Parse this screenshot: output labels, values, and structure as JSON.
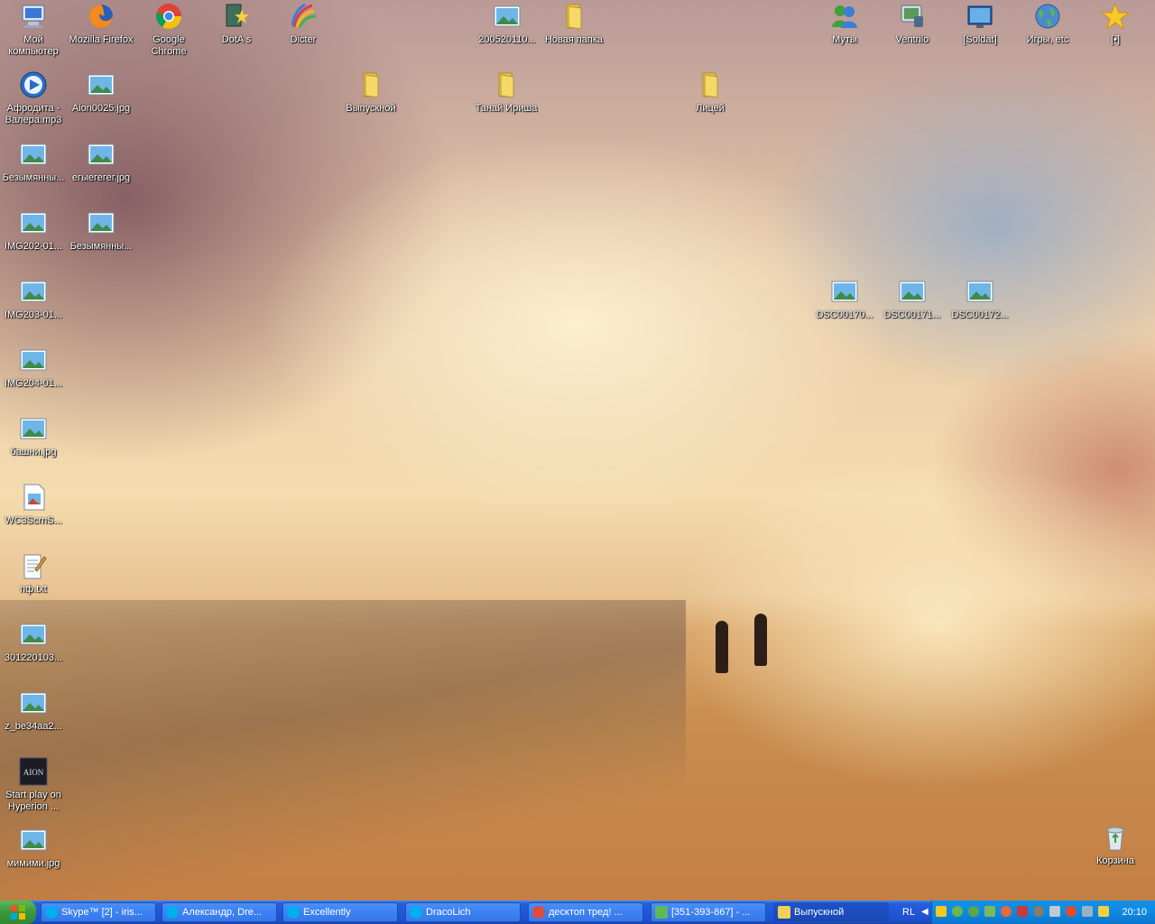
{
  "desktop_icons": [
    {
      "label": "Мой компьютер",
      "icon": "my-computer-icon"
    },
    {
      "label": "Mozilla Firefox",
      "icon": "firefox-icon"
    },
    {
      "label": "Google Chrome",
      "icon": "chrome-icon"
    },
    {
      "label": "DotA s",
      "icon": "dota-icon"
    },
    {
      "label": "Dicter",
      "icon": "dicter-icon"
    },
    {
      "label": "200520110...",
      "icon": "image-file-icon"
    },
    {
      "label": "Новая папка",
      "icon": "folder-icon"
    },
    {
      "label": "Муты",
      "icon": "contacts-icon"
    },
    {
      "label": "Ventrilo",
      "icon": "ventrilo-icon"
    },
    {
      "label": "[Soldat]",
      "icon": "soldat-icon"
    },
    {
      "label": "Игры, etc",
      "icon": "globe-icon"
    },
    {
      "label": "[•]",
      "icon": "star-icon"
    },
    {
      "label": "Афродита - Валера.mp3",
      "icon": "media-player-icon"
    },
    {
      "label": "Aion0025.jpg",
      "icon": "image-file-icon"
    },
    {
      "label": "Выпускной",
      "icon": "folder-icon"
    },
    {
      "label": "Танай Ириша",
      "icon": "folder-icon"
    },
    {
      "label": "Лицей",
      "icon": "folder-icon"
    },
    {
      "label": "Безымянны...",
      "icon": "image-file-icon"
    },
    {
      "label": "егыегегег.jpg",
      "icon": "image-file-icon"
    },
    {
      "label": "IMG202-01...",
      "icon": "image-file-icon"
    },
    {
      "label": "Безымянны...",
      "icon": "image-file-icon"
    },
    {
      "label": "IMG203-01...",
      "icon": "image-file-icon"
    },
    {
      "label": "DSC00170...",
      "icon": "image-file-icon"
    },
    {
      "label": "DSC00171...",
      "icon": "image-file-icon"
    },
    {
      "label": "DSC00172...",
      "icon": "image-file-icon"
    },
    {
      "label": "IMG204-01...",
      "icon": "image-file-icon"
    },
    {
      "label": "башни.jpg",
      "icon": "image-file-icon"
    },
    {
      "label": "WC3ScrnS...",
      "icon": "picture-doc-icon"
    },
    {
      "label": "пф.txt",
      "icon": "text-file-icon"
    },
    {
      "label": "301220103...",
      "icon": "image-file-icon"
    },
    {
      "label": "z_be34aa2...",
      "icon": "image-file-icon"
    },
    {
      "label": "Start play on Hyperion ...",
      "icon": "aion-icon"
    },
    {
      "label": "мимими.jpg",
      "icon": "image-file-icon"
    },
    {
      "label": "Корзина",
      "icon": "recycle-bin-icon"
    }
  ],
  "taskbar": {
    "start_icon": "windows-logo-icon",
    "tasks": [
      {
        "label": "Skype™ [2] - iris...",
        "icon": "skype-icon",
        "color": "#00aff0"
      },
      {
        "label": "Александр, Dre...",
        "icon": "skype-chat-icon",
        "color": "#00aff0"
      },
      {
        "label": "Excellently",
        "icon": "skype-chat-icon",
        "color": "#00aff0"
      },
      {
        "label": "DracoLich",
        "icon": "skype-chat-icon",
        "color": "#00aff0"
      },
      {
        "label": "десктоп тред! ...",
        "icon": "chrome-icon",
        "color": "#e04a3a"
      },
      {
        "label": "[351-393-867] - ...",
        "icon": "chat-icon",
        "color": "#5fb85a"
      },
      {
        "label": "Выпускной",
        "icon": "folder-icon",
        "color": "#f1cf5b"
      }
    ],
    "language": "RL",
    "clock": "20:10"
  },
  "colors": {
    "taskbar_blue": "#245edb",
    "tray_blue": "#0e8ae0",
    "start_green": "#3c9a3c",
    "folder_yellow": "#f1cf5b"
  }
}
